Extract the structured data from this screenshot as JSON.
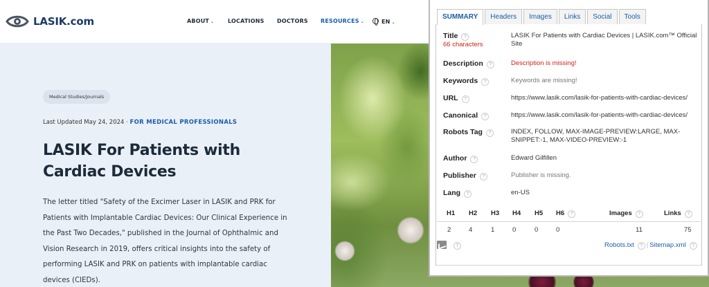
{
  "site": {
    "logo_text": "LASIK.com",
    "nav": [
      {
        "label": "ABOUT",
        "dropdown": true
      },
      {
        "label": "LOCATIONS",
        "dropdown": false
      },
      {
        "label": "DOCTORS",
        "dropdown": false
      },
      {
        "label": "RESOURCES",
        "dropdown": true
      },
      {
        "label": "EN",
        "dropdown": true
      }
    ],
    "accent_color": "#1a5ea8"
  },
  "article": {
    "tag": "Medical Studies/Journals",
    "updated_prefix": "Last Updated May 24, 2024 · ",
    "audience": "FOR MEDICAL PROFESSIONALS",
    "title": "LASIK For Patients with Cardiac Devices",
    "body": "The letter titled \"Safety of the Excimer Laser in LASIK and PRK for Patients with Implantable Cardiac Devices: Our Clinical Experience in the Past Two Decades,\" published in the Journal of Ophthalmic and Vision Research in 2019, offers critical insights into the safety of performing LASIK and PRK on patients with implantable cardiac devices (CIEDs)."
  },
  "seo_panel": {
    "tabs": [
      "SUMMARY",
      "Headers",
      "Images",
      "Links",
      "Social",
      "Tools"
    ],
    "active_tab": "SUMMARY",
    "fields": {
      "title_label": "Title",
      "title_chars": "66 characters",
      "title_value": "LASIK For Patients with Cardiac Devices | LASIK.com™ Official Site",
      "description_label": "Description",
      "description_value": "Description is missing!",
      "keywords_label": "Keywords",
      "keywords_value": "Keywords are missing!",
      "url_label": "URL",
      "url_value": "https://www.lasik.com/lasik-for-patients-with-cardiac-devices/",
      "canonical_label": "Canonical",
      "canonical_value": "https://www.lasik.com/lasik-for-patients-with-cardiac-devices/",
      "robots_label": "Robots Tag",
      "robots_value": "INDEX, FOLLOW, MAX-IMAGE-PREVIEW:LARGE, MAX-SNIPPET:-1, MAX-VIDEO-PREVIEW:-1",
      "author_label": "Author",
      "author_value": "Edward Gilfillen",
      "publisher_label": "Publisher",
      "publisher_value": "Publisher is missing.",
      "lang_label": "Lang",
      "lang_value": "en-US"
    },
    "headings": {
      "labels": [
        "H1",
        "H2",
        "H3",
        "H4",
        "H5",
        "H6"
      ],
      "values": [
        "2",
        "4",
        "1",
        "0",
        "0",
        "0"
      ],
      "images_label": "Images",
      "images_value": "11",
      "links_label": "Links",
      "links_value": "75"
    },
    "robots_link": "Robots.txt",
    "sitemap_link": "Sitemap.xml",
    "missing_color": "#d0221b"
  }
}
